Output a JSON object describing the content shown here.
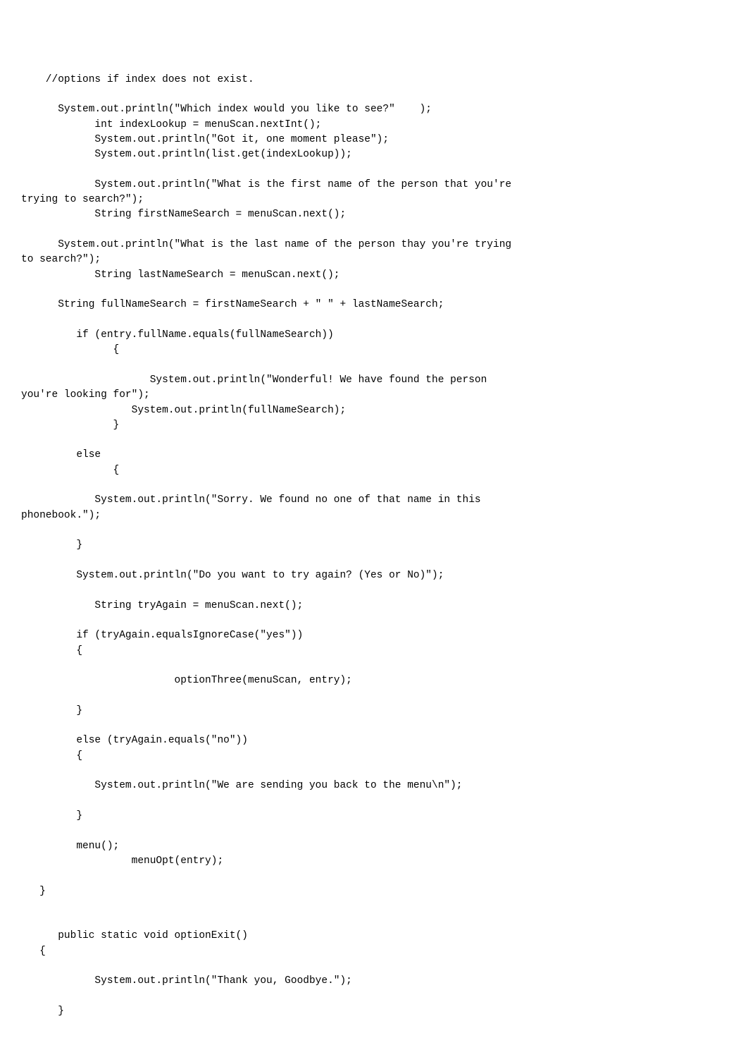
{
  "code_lines": [
    "",
    "",
    "    //options if index does not exist.",
    "",
    "      System.out.println(\"Which index would you like to see?\"    );",
    "            int indexLookup = menuScan.nextInt();",
    "            System.out.println(\"Got it, one moment please\");",
    "            System.out.println(list.get(indexLookup));",
    "",
    "            System.out.println(\"What is the first name of the person that you're",
    "trying to search?\");",
    "            String firstNameSearch = menuScan.next();",
    "",
    "      System.out.println(\"What is the last name of the person thay you're trying",
    "to search?\");",
    "            String lastNameSearch = menuScan.next();",
    "",
    "      String fullNameSearch = firstNameSearch + \" \" + lastNameSearch;",
    "",
    "         if (entry.fullName.equals(fullNameSearch))",
    "               {",
    "",
    "                     System.out.println(\"Wonderful! We have found the person",
    "you're looking for\");",
    "                  System.out.println(fullNameSearch);",
    "               }",
    "",
    "         else",
    "               {",
    "",
    "            System.out.println(\"Sorry. We found no one of that name in this",
    "phonebook.\");",
    "",
    "         }",
    "",
    "         System.out.println(\"Do you want to try again? (Yes or No)\");",
    "",
    "            String tryAgain = menuScan.next();",
    "",
    "         if (tryAgain.equalsIgnoreCase(\"yes\"))",
    "         {",
    "",
    "                         optionThree(menuScan, entry);",
    "",
    "         }",
    "",
    "         else (tryAgain.equals(\"no\"))",
    "         {",
    "",
    "            System.out.println(\"We are sending you back to the menu\\n\");",
    "",
    "         }",
    "",
    "         menu();",
    "                  menuOpt(entry);",
    "",
    "   }",
    "",
    "",
    "      public static void optionExit()",
    "   {",
    "",
    "            System.out.println(\"Thank you, Goodbye.\");",
    "",
    "      }"
  ]
}
